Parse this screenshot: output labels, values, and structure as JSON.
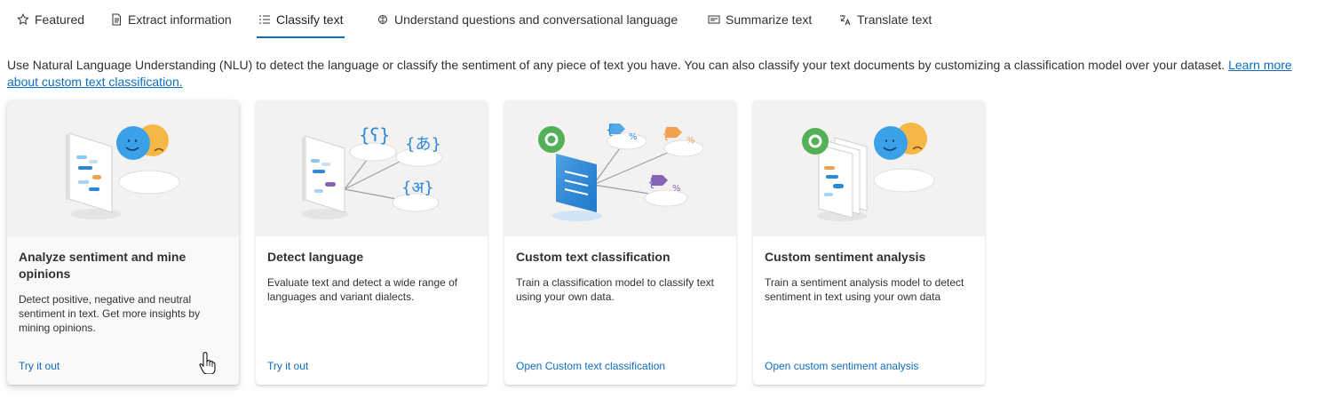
{
  "tabs": [
    {
      "label": "Featured",
      "icon": "star-icon"
    },
    {
      "label": "Extract information",
      "icon": "document-icon"
    },
    {
      "label": "Classify text",
      "icon": "list-icon",
      "active": true
    },
    {
      "label": "Understand questions and conversational language",
      "icon": "brain-icon"
    },
    {
      "label": "Summarize text",
      "icon": "summary-icon"
    },
    {
      "label": "Translate text",
      "icon": "translate-icon"
    }
  ],
  "intro": {
    "text": "Use Natural Language Understanding (NLU) to detect the language or classify the sentiment of any piece of text you have. You can also classify your text documents by customizing a classification model over your dataset. ",
    "link": "Learn more about custom text classification."
  },
  "cards": [
    {
      "title": "Analyze sentiment and mine opinions",
      "description": "Detect positive, negative and neutral sentiment in text. Get more insights by mining opinions.",
      "link": "Try it out"
    },
    {
      "title": "Detect language",
      "description": "Evaluate text and detect a wide range of languages and variant dialects.",
      "link": "Try it out",
      "glyphs": [
        "{ʕ}",
        "{あ}",
        "{अ}"
      ]
    },
    {
      "title": "Custom text classification",
      "description": "Train a classification model to classify text using your own data.",
      "link": "Open Custom text classification"
    },
    {
      "title": "Custom sentiment analysis",
      "description": "Train a sentiment analysis model to detect sentiment in text using your own data",
      "link": "Open custom sentiment analysis"
    }
  ],
  "colors": {
    "accent": "#0f6cbd",
    "text": "#323130",
    "card_art_bg": "#f3f2f1"
  }
}
